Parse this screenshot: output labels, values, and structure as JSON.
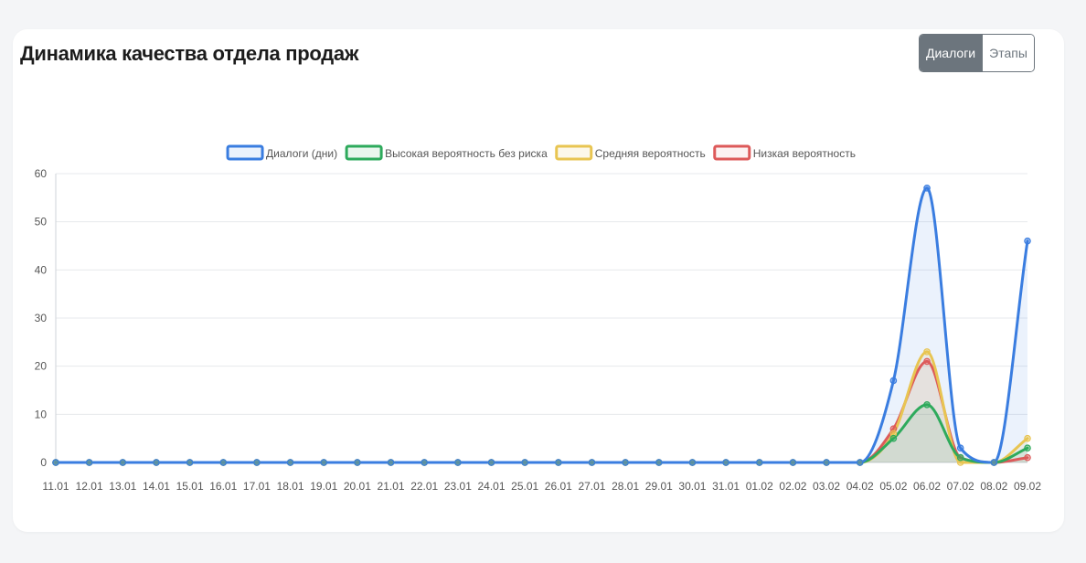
{
  "card": {
    "title": "Динамика качества отдела продаж"
  },
  "toggle": {
    "dialogs_label": "Диалоги",
    "stages_label": "Этапы",
    "active": "dialogs"
  },
  "chart_data": {
    "type": "line",
    "title": "",
    "xlabel": "",
    "ylabel": "",
    "ylim": [
      0,
      60
    ],
    "yticks": [
      0,
      10,
      20,
      30,
      40,
      50,
      60
    ],
    "grid": true,
    "legend_position": "top",
    "smooth": true,
    "categories": [
      "11.01",
      "12.01",
      "13.01",
      "14.01",
      "15.01",
      "16.01",
      "17.01",
      "18.01",
      "19.01",
      "20.01",
      "21.01",
      "22.01",
      "23.01",
      "24.01",
      "25.01",
      "26.01",
      "27.01",
      "28.01",
      "29.01",
      "30.01",
      "31.01",
      "01.02",
      "02.02",
      "03.02",
      "04.02",
      "05.02",
      "06.02",
      "07.02",
      "08.02",
      "09.02"
    ],
    "series": [
      {
        "name": "Диалоги (дни)",
        "color": "#3a7de0",
        "fill": "rgba(58,125,224,0.10)",
        "values": [
          0,
          0,
          0,
          0,
          0,
          0,
          0,
          0,
          0,
          0,
          0,
          0,
          0,
          0,
          0,
          0,
          0,
          0,
          0,
          0,
          0,
          0,
          0,
          0,
          0,
          17,
          57,
          3,
          0,
          46
        ]
      },
      {
        "name": "Высокая вероятность без риска",
        "color": "#2eaa5c",
        "fill": "rgba(46,170,92,0.10)",
        "values": [
          0,
          0,
          0,
          0,
          0,
          0,
          0,
          0,
          0,
          0,
          0,
          0,
          0,
          0,
          0,
          0,
          0,
          0,
          0,
          0,
          0,
          0,
          0,
          0,
          0,
          5,
          12,
          1,
          0,
          3
        ]
      },
      {
        "name": "Средняя вероятность",
        "color": "#e8c552",
        "fill": "rgba(232,197,82,0.12)",
        "values": [
          0,
          0,
          0,
          0,
          0,
          0,
          0,
          0,
          0,
          0,
          0,
          0,
          0,
          0,
          0,
          0,
          0,
          0,
          0,
          0,
          0,
          0,
          0,
          0,
          0,
          6,
          23,
          0,
          0,
          5
        ]
      },
      {
        "name": "Низкая вероятность",
        "color": "#dd5a5a",
        "fill": "rgba(221,90,90,0.08)",
        "values": [
          0,
          0,
          0,
          0,
          0,
          0,
          0,
          0,
          0,
          0,
          0,
          0,
          0,
          0,
          0,
          0,
          0,
          0,
          0,
          0,
          0,
          0,
          0,
          0,
          0,
          7,
          21,
          1,
          0,
          1
        ]
      }
    ]
  }
}
